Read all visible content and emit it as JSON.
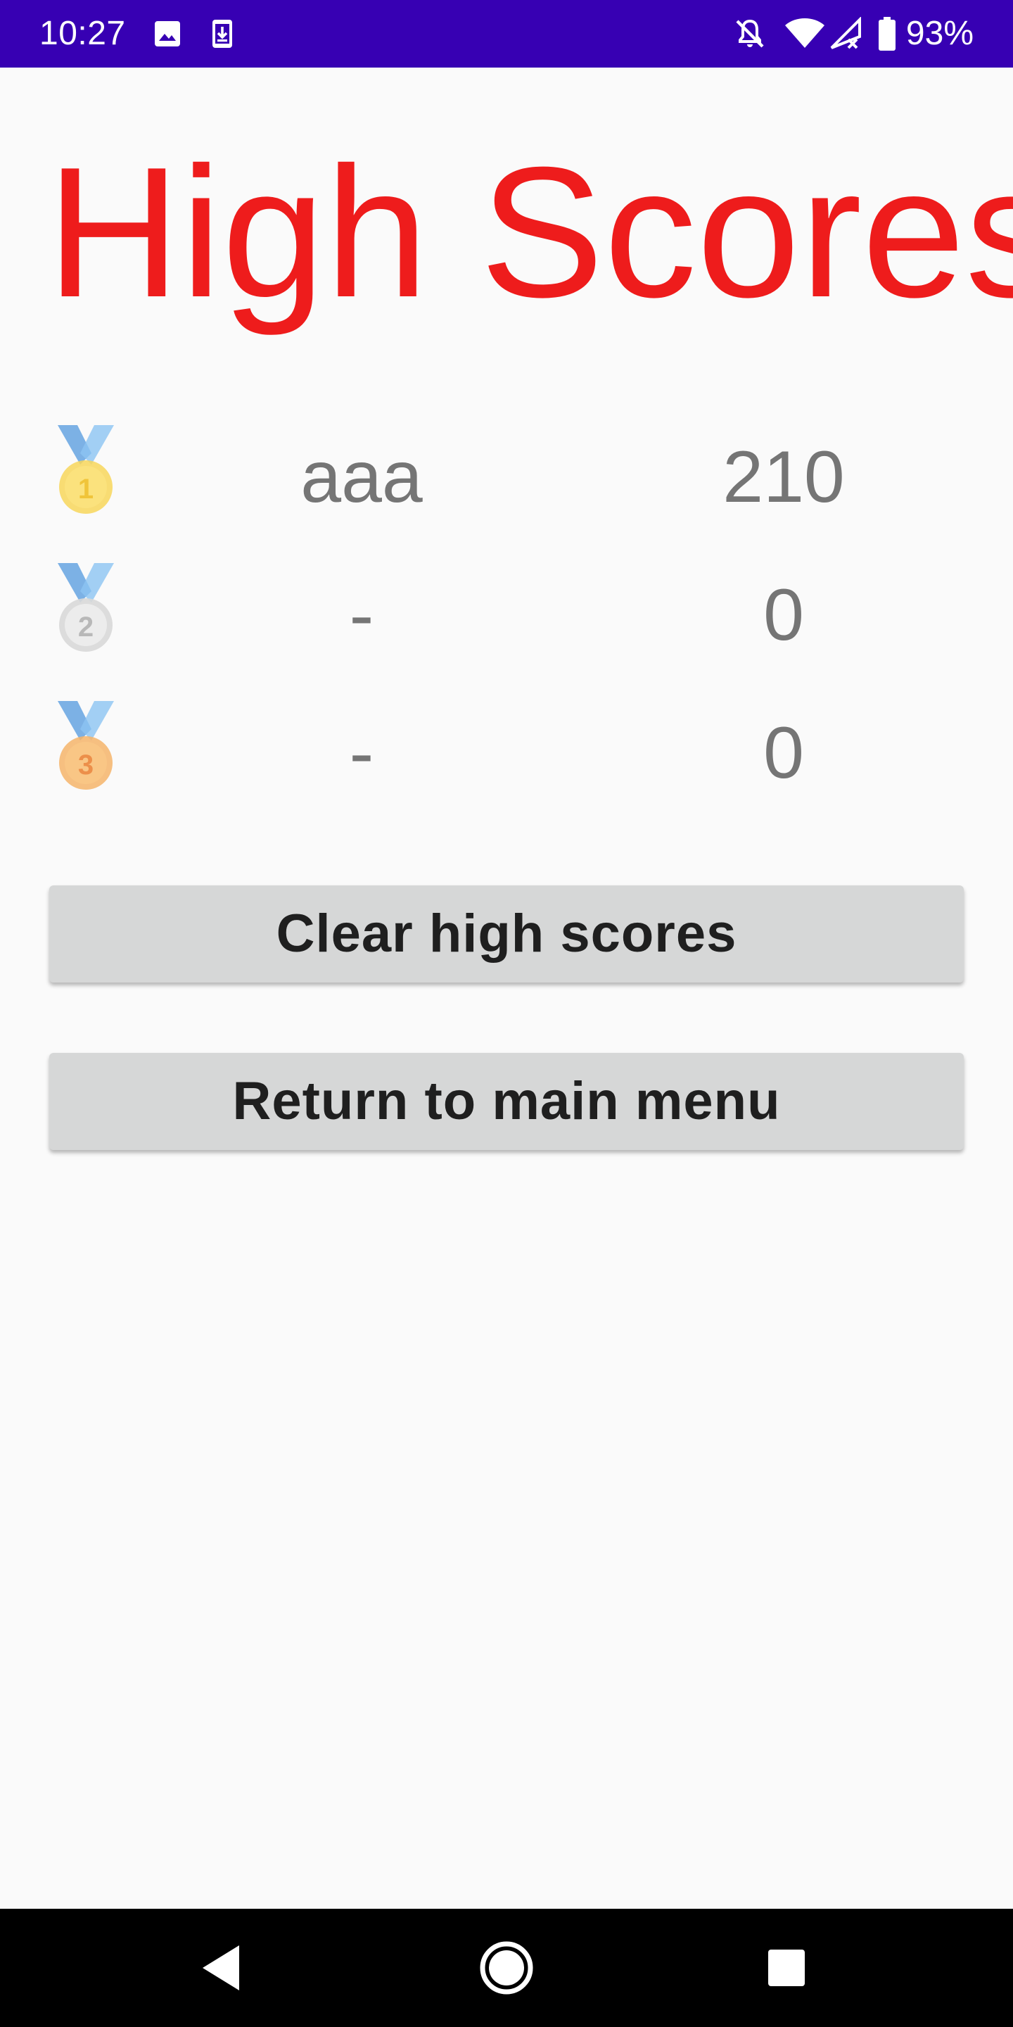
{
  "status_bar": {
    "time": "10:27",
    "battery": "93%",
    "background_color": "#3700b3",
    "left_icons": [
      "image-icon",
      "download-icon"
    ],
    "right_icons": [
      "notifications-off-icon",
      "wifi-icon",
      "signal-icon",
      "battery-icon"
    ]
  },
  "title": "High Scores",
  "title_color": "#ee1c1c",
  "scores": [
    {
      "rank": "1",
      "medal": "gold-medal-icon",
      "name": "aaa",
      "score": "210"
    },
    {
      "rank": "2",
      "medal": "silver-medal-icon",
      "name": "-",
      "score": "0"
    },
    {
      "rank": "3",
      "medal": "bronze-medal-icon",
      "name": "-",
      "score": "0"
    }
  ],
  "buttons": {
    "clear": "Clear high scores",
    "return": "Return to main menu"
  },
  "nav_bar": {
    "icons": [
      "back-icon",
      "home-icon",
      "recents-icon"
    ]
  }
}
